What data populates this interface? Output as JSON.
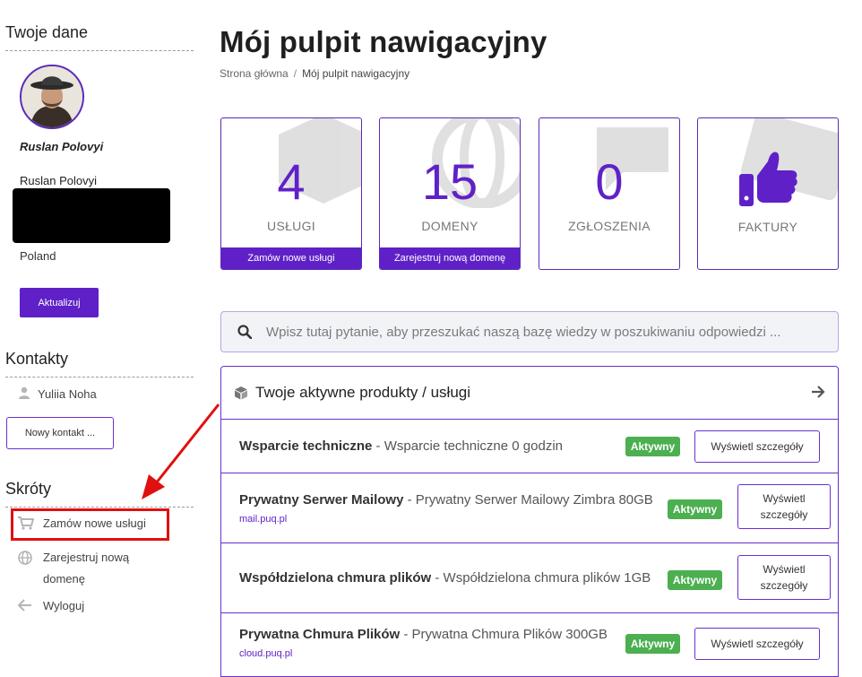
{
  "sidebar": {
    "profile": {
      "heading": "Twoje dane",
      "name_bold": "Ruslan Polovyi",
      "name": "Ruslan Polovyi",
      "country": "Poland",
      "update_label": "Aktualizuj"
    },
    "contacts": {
      "heading": "Kontakty",
      "contact_name": "Yuliia Noha",
      "new_contact_label": "Nowy kontakt ..."
    },
    "shortcuts": {
      "heading": "Skróty",
      "items": [
        {
          "label": "Zamów nowe usługi",
          "icon": "cart-icon"
        },
        {
          "label": "Zarejestruj nową domenę",
          "icon": "globe-icon"
        },
        {
          "label": "Wyloguj",
          "icon": "arrow-left-icon"
        }
      ]
    }
  },
  "main": {
    "title": "Mój pulpit nawigacyjny",
    "breadcrumb": {
      "home": "Strona główna",
      "separator": "/",
      "current": "Mój pulpit nawigacyjny"
    },
    "tiles": [
      {
        "value": "4",
        "label": "USŁUGI",
        "footer": "Zamów nowe usługi"
      },
      {
        "value": "15",
        "label": "DOMENY",
        "footer": "Zarejestruj nową domenę"
      },
      {
        "value": "0",
        "label": "ZGŁOSZENIA"
      },
      {
        "label": "FAKTURY",
        "icon": "thumbs-up-icon"
      }
    ],
    "search": {
      "placeholder": "Wpisz tutaj pytanie, aby przeszukać naszą bazę wiedzy w poszukiwaniu odpowiedzi ..."
    },
    "products": {
      "title": "Twoje aktywne produkty / usługi",
      "items": [
        {
          "name": "Wsparcie techniczne",
          "desc": " - Wsparcie techniczne 0 godzin",
          "domain": "",
          "status": "Aktywny",
          "details": "Wyświetl szczegóły"
        },
        {
          "name": "Prywatny Serwer Mailowy",
          "desc": " - Prywatny Serwer Mailowy Zimbra 80GB",
          "domain": "mail.puq.pl",
          "status": "Aktywny",
          "details": "Wyświetl szczegóły"
        },
        {
          "name": "Współdzielona chmura plików",
          "desc": " - Współdzielona chmura plików 1GB",
          "domain": "",
          "status": "Aktywny",
          "details": "Wyświetl szczegóły"
        },
        {
          "name": "Prywatna Chmura Plików",
          "desc": " - Prywatna Chmura Plików 300GB",
          "domain": "cloud.puq.pl",
          "status": "Aktywny",
          "details": "Wyświetl szczegóły"
        }
      ]
    }
  },
  "colors": {
    "accent": "#5f21c7",
    "active": "#4caf50",
    "highlight": "#e01010"
  }
}
